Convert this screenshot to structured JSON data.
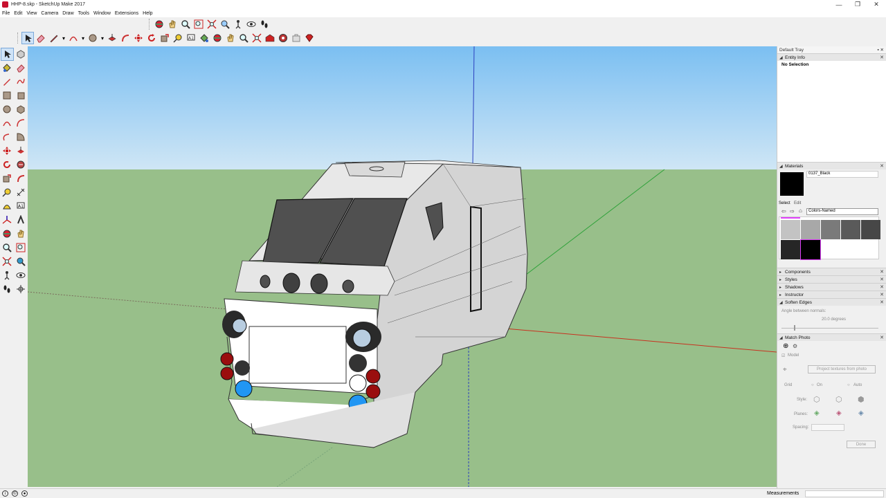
{
  "window": {
    "title": "HHP-8.skp - SketchUp Make 2017",
    "minimize": "—",
    "restore": "❐",
    "close": "✕"
  },
  "menu": [
    "File",
    "Edit",
    "View",
    "Camera",
    "Draw",
    "Tools",
    "Window",
    "Extensions",
    "Help"
  ],
  "tray": {
    "title": "Default Tray",
    "entity_info": {
      "header": "Entity Info",
      "selection": "No Selection"
    },
    "materials": {
      "header": "Materials",
      "material_name": "0137_Black",
      "tabs": [
        "Select",
        "Edit"
      ],
      "collection": "Colors-Named",
      "swatch_colors": [
        "#c3c3c3",
        "#a8a8a8",
        "#7a7a7a",
        "#5a5a5a",
        "#474747",
        "#262626",
        "#000000"
      ]
    },
    "collapsed_panels": [
      "Components",
      "Styles",
      "Shadows",
      "Instructor"
    ],
    "soften_edges": {
      "header": "Soften Edges",
      "angle_label": "Angle between normals:",
      "angle_value": "20.0  degrees"
    },
    "match_photo": {
      "header": "Match Photo",
      "model_label": "Model",
      "project_button": "Project textures from photo",
      "grid_label": "Grid",
      "grid_on": "On",
      "grid_auto": "Auto",
      "style_label": "Style:",
      "planes_label": "Planes:",
      "spacing_label": "Spacing:",
      "done_button": "Done"
    }
  },
  "status": {
    "measurements_label": "Measurements"
  },
  "colors": {
    "sky_top": "#7bbff2",
    "sky_bottom": "#cfe6f5",
    "ground": "#98bf8a",
    "accent_red": "#c8102e"
  }
}
